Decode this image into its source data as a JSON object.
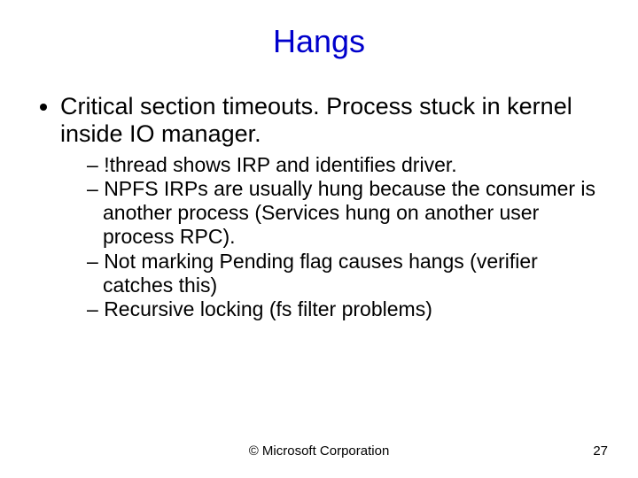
{
  "title": "Hangs",
  "bullets": {
    "main": "Critical section timeouts. Process stuck in kernel inside IO manager.",
    "sub": [
      "!thread shows IRP and identifies driver.",
      "NPFS IRPs are usually hung because the consumer is another process (Services hung on another user process RPC).",
      "Not marking Pending flag causes hangs (verifier catches this)",
      "Recursive locking (fs filter problems)"
    ]
  },
  "footer": {
    "center": "© Microsoft Corporation",
    "page": "27"
  }
}
